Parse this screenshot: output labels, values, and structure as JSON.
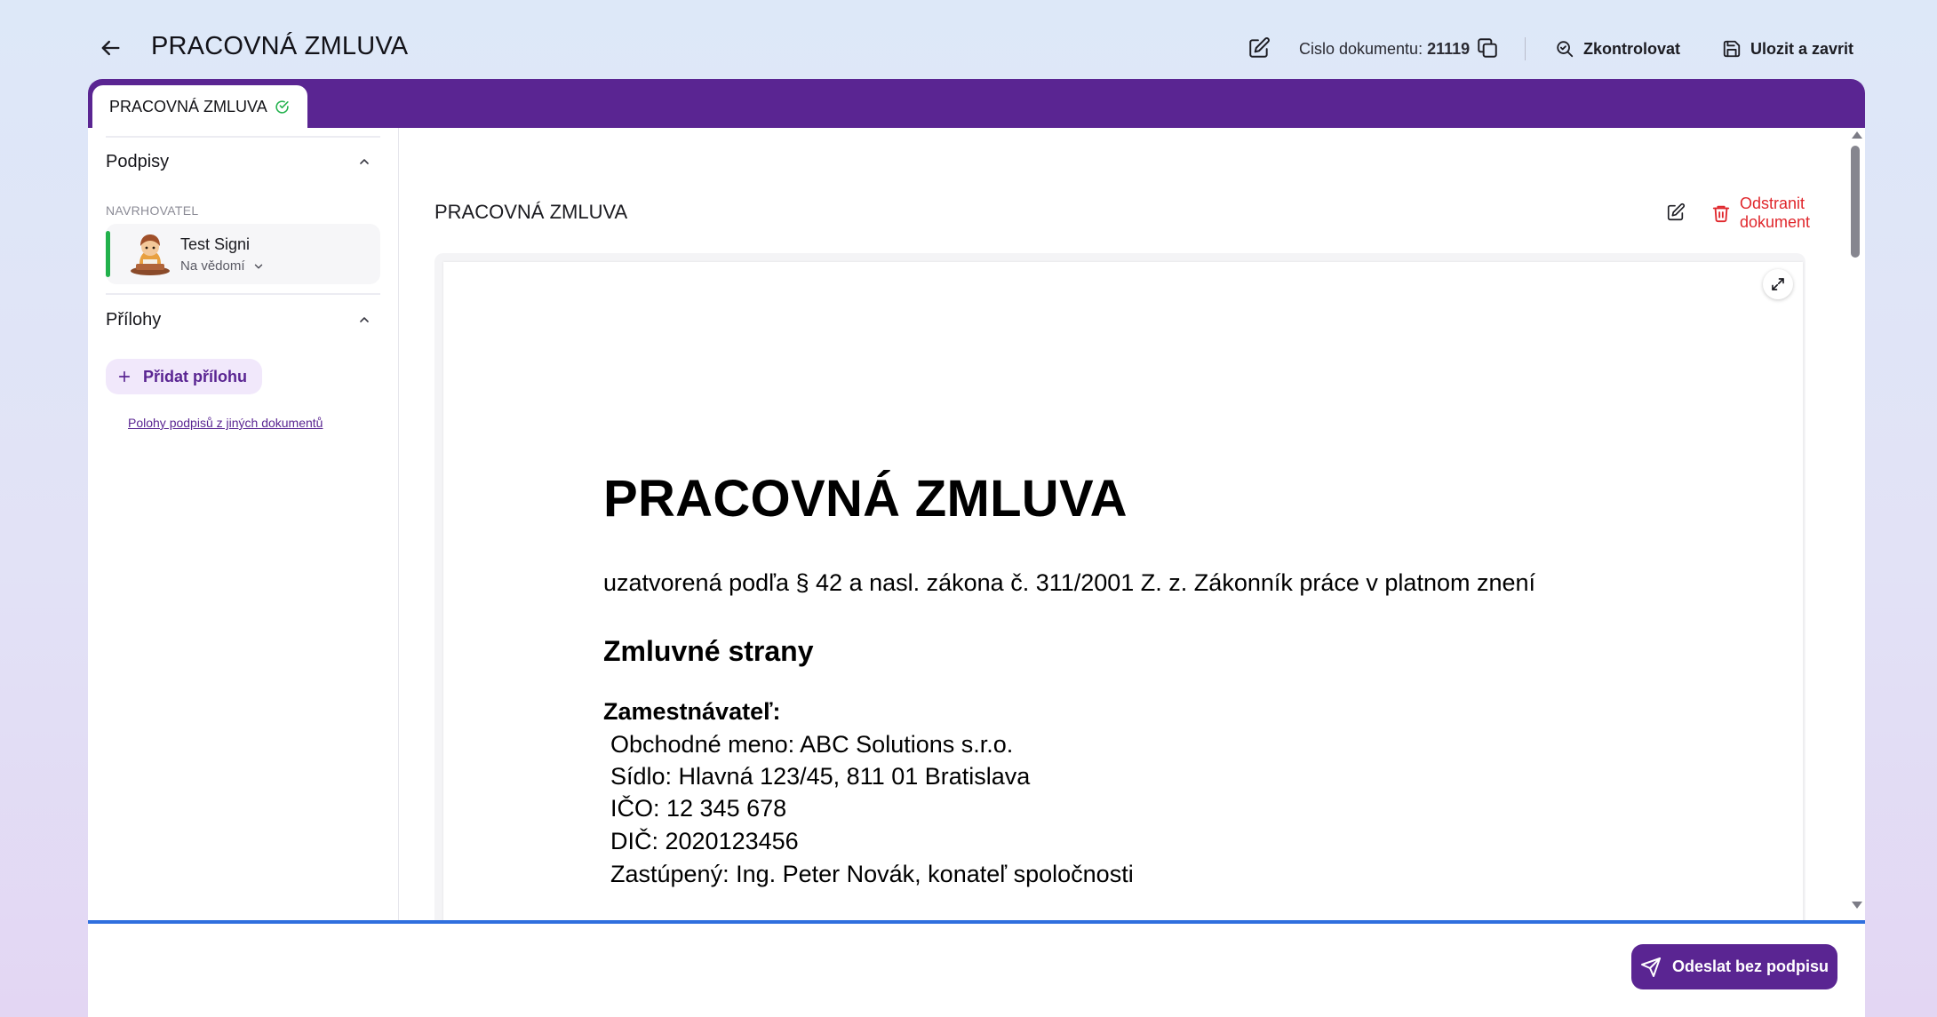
{
  "header": {
    "title": "PRACOVNÁ ZMLUVA",
    "doc_number_label": "Cislo dokumentu:",
    "doc_number_value": "21119",
    "check_label": "Zkontrolovat",
    "save_label": "Ulozit a zavrit"
  },
  "tabs": [
    {
      "label": "PRACOVNÁ ZMLUVA",
      "status": "check-circle-icon"
    }
  ],
  "sidebar": {
    "signatures_title": "Podpisy",
    "role_label": "NAVRHOVATEL",
    "signer": {
      "name": "Test Signi",
      "status": "Na vědomí"
    },
    "attachments_title": "Přílohy",
    "add_attachment_label": "Přidat přílohu",
    "signature_positions_link": "Polohy podpisů z jiných dokumentů"
  },
  "document": {
    "title": "PRACOVNÁ ZMLUVA",
    "delete_label": "Odstranit dokument",
    "content": {
      "heading": "PRACOVNÁ ZMLUVA",
      "subtitle": "uzatvorená podľa § 42 a nasl. zákona č. 311/2001 Z. z. Zákonník práce v platnom znení",
      "section_title": "Zmluvné strany",
      "party_title": "Zamestnávateľ:",
      "lines": [
        "Obchodné meno: ABC Solutions s.r.o.",
        "Sídlo: Hlavná 123/45, 811 01 Bratislava",
        "IČO: 12 345 678",
        "DIČ: 2020123456",
        "Zastúpený: Ing. Peter Novák, konateľ spoločnosti"
      ]
    }
  },
  "footer": {
    "send_label": "Odeslat bez podpisu"
  },
  "colors": {
    "brand": "#5a2592",
    "danger": "#e0272c",
    "success": "#22b14c",
    "progress": "#2f6fde"
  }
}
